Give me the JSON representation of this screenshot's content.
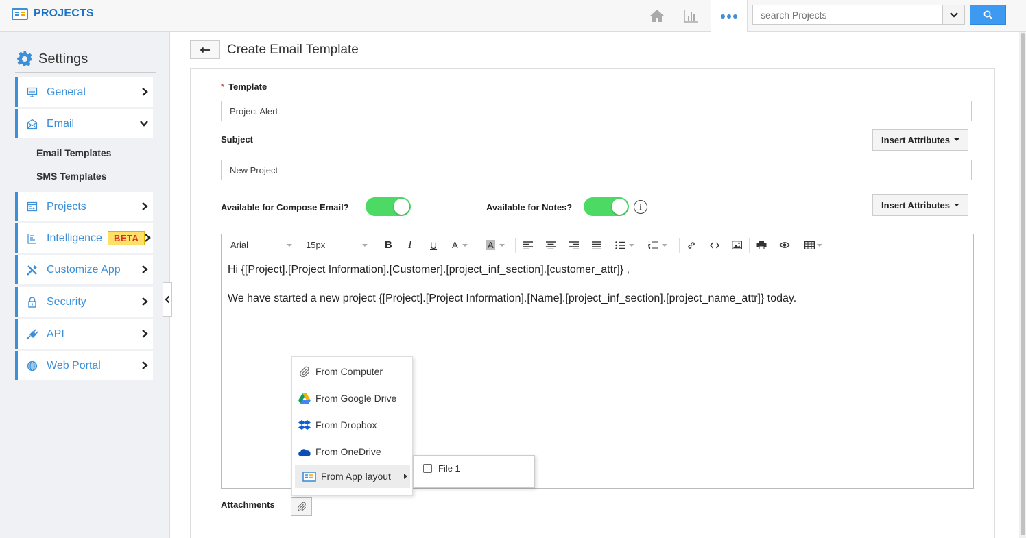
{
  "header": {
    "brand": "PROJECTS",
    "search_placeholder": "search Projects",
    "icons": [
      "home-icon",
      "chart-icon",
      "more-icon",
      "chevron-down-icon",
      "search-icon"
    ]
  },
  "sidebar": {
    "title": "Settings",
    "items": [
      {
        "label": "General",
        "icon": "monitor-icon"
      },
      {
        "label": "Email",
        "icon": "envelope-icon"
      },
      {
        "label": "Projects",
        "icon": "projects-icon"
      },
      {
        "label": "Intelligence",
        "icon": "intelligence-icon",
        "badge": "BETA"
      },
      {
        "label": "Customize App",
        "icon": "tools-icon"
      },
      {
        "label": "Security",
        "icon": "lock-icon"
      },
      {
        "label": "API",
        "icon": "plug-icon"
      },
      {
        "label": "Web Portal",
        "icon": "globe-icon"
      }
    ],
    "email_sub": [
      "Email Templates",
      "SMS Templates"
    ]
  },
  "page": {
    "title": "Create Email Template",
    "template_label": "Template",
    "template_required_mark": "*",
    "template_value": "Project Alert",
    "subject_label": "Subject",
    "subject_value": "New Project",
    "insert_attributes": "Insert Attributes",
    "compose_label": "Available for Compose Email?",
    "compose_on": true,
    "notes_label": "Available for Notes?",
    "notes_on": true,
    "info_glyph": "i",
    "attachments_label": "Attachments"
  },
  "editor": {
    "font": "Arial",
    "size": "15px",
    "line1": "Hi {[Project].[Project Information].[Customer].[project_inf_section].[customer_attr]} ,",
    "line2": "We have started a new project {[Project].[Project Information].[Name].[project_inf_section].[project_name_attr]} today."
  },
  "attach_menu": {
    "items": [
      "From Computer",
      "From Google Drive",
      "From Dropbox",
      "From OneDrive",
      "From App layout"
    ],
    "submenu_item": "File 1"
  },
  "colors": {
    "accent": "#3d8fd8",
    "toggle_on": "#4cd964",
    "beta_bg": "#ffe066",
    "beta_text": "#d32f2f"
  }
}
